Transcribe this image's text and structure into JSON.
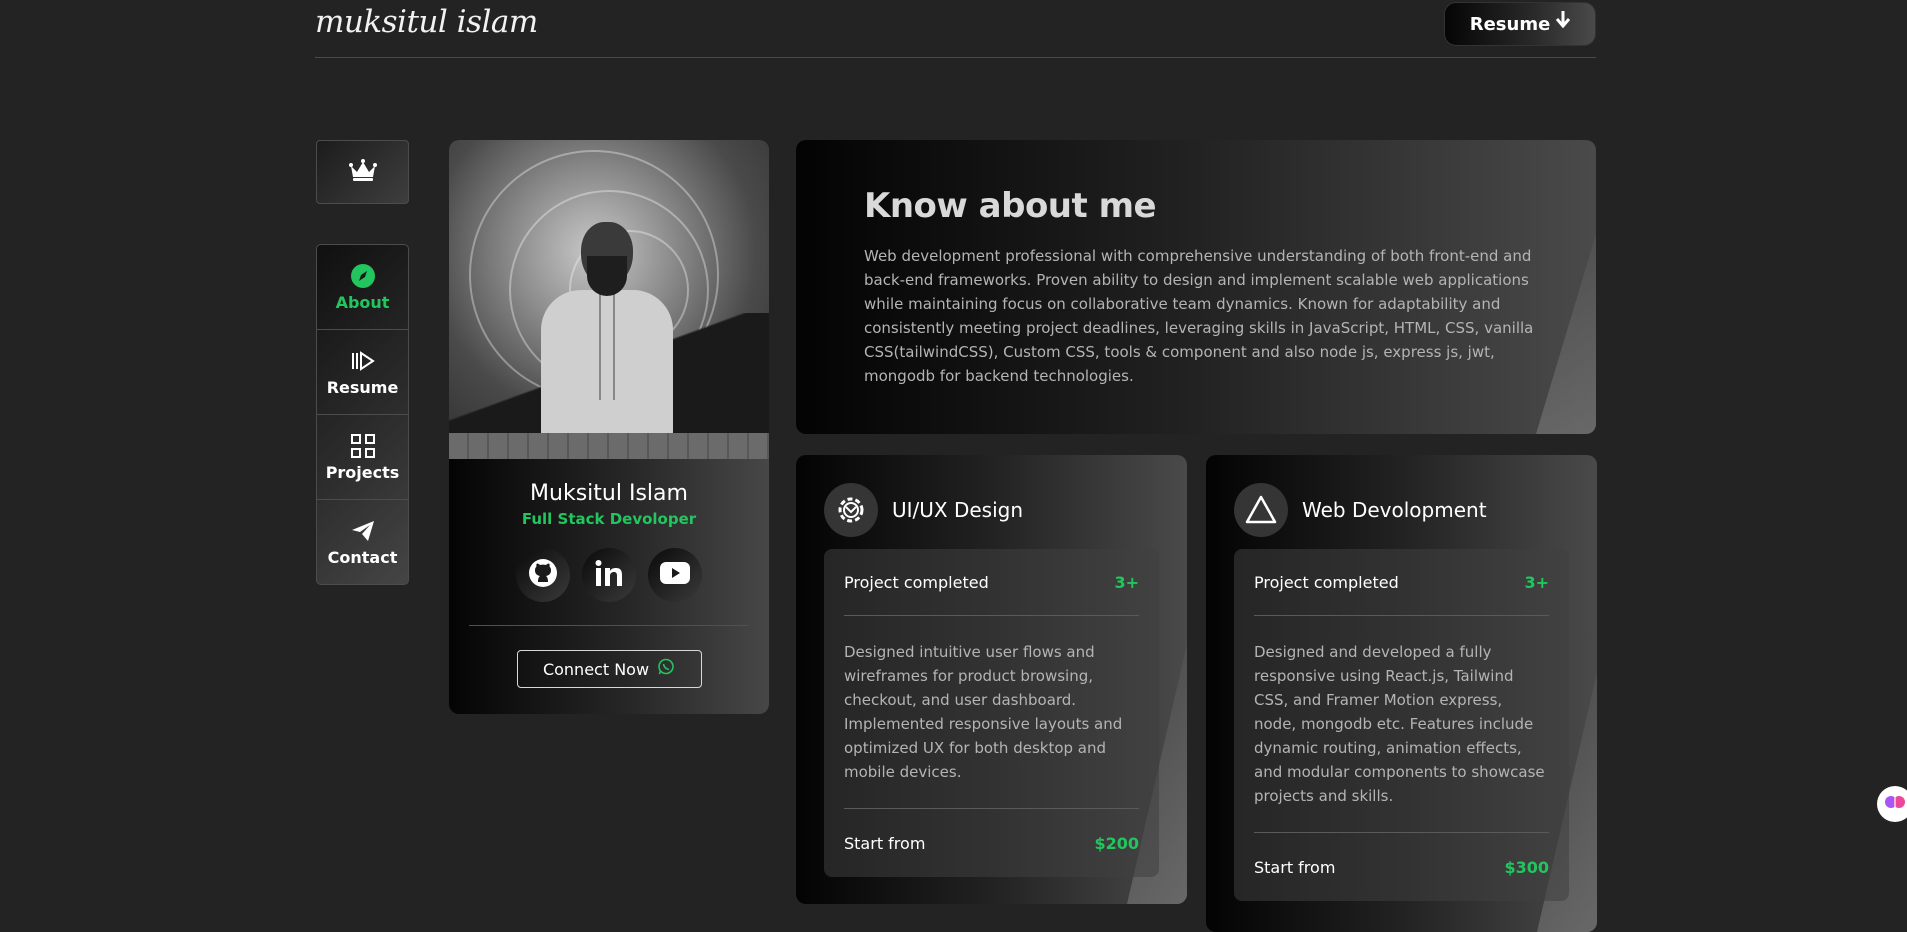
{
  "header": {
    "logo": "muksitul islam",
    "resume_label": "Resume",
    "resume_icon": "arrow-down-icon"
  },
  "nav": {
    "items": [
      {
        "label": "About",
        "icon": "compass-icon",
        "active": true
      },
      {
        "label": "Resume",
        "icon": "resume-icon",
        "active": false
      },
      {
        "label": "Projects",
        "icon": "grid-icon",
        "active": false
      },
      {
        "label": "Contact",
        "icon": "send-icon",
        "active": false
      }
    ]
  },
  "profile": {
    "name": "Muksitul Islam",
    "role": "Full Stack Devoloper",
    "socials": [
      "github-icon",
      "linkedin-icon",
      "youtube-icon"
    ],
    "connect_label": "Connect Now",
    "connect_icon": "whatsapp-icon"
  },
  "about": {
    "title": "Know about me",
    "text": "Web development professional with comprehensive understanding of both front-end and back-end frameworks. Proven ability to design and implement scalable web applications while maintaining focus on collaborative team dynamics. Known for adaptability and consistently meeting project deadlines, leveraging skills in JavaScript, HTML, CSS, vanilla CSS(tailwindCSS), Custom CSS, tools & component and also node js, express js, jwt, mongodb for backend technologies."
  },
  "services": [
    {
      "title": "UI/UX Design",
      "icon": "gear-icon",
      "projects_label": "Project completed",
      "projects_count": "3+",
      "description": "Designed intuitive user flows and wireframes for product browsing, checkout, and user dashboard. Implemented responsive layouts and optimized UX for both desktop and mobile devices.",
      "price_label": "Start from",
      "price": "$200"
    },
    {
      "title": "Web Devolopment",
      "icon": "triangle-icon",
      "projects_label": "Project completed",
      "projects_count": "3+",
      "description": "Designed and developed a fully responsive using React.js, Tailwind CSS, and Framer Motion express, node, mongodb etc. Features include dynamic routing, animation effects, and modular components to showcase projects and skills.",
      "price_label": "Start from",
      "price": "$300"
    }
  ],
  "colors": {
    "accent": "#22c55e",
    "background": "#232323"
  }
}
